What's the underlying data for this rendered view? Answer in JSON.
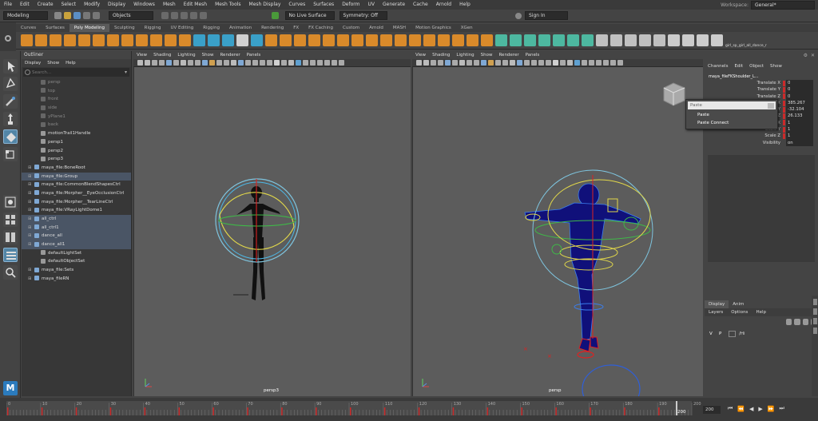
{
  "menu": [
    "File",
    "Edit",
    "Create",
    "Select",
    "Modify",
    "Display",
    "Windows",
    "Mesh",
    "Edit Mesh",
    "Mesh Tools",
    "Mesh Display",
    "Curves",
    "Surfaces",
    "Deform",
    "UV",
    "Generate",
    "Cache",
    "Arnold",
    "Help"
  ],
  "workspace": {
    "label": "Workspace:",
    "value": "General*"
  },
  "status": {
    "mode": "Modeling",
    "objects": "Objects",
    "live_surface": "No Live Surface",
    "symmetry": "Symmetry: Off",
    "sign_in": "Sign In"
  },
  "shelf_tabs": [
    "Curves",
    "Surfaces",
    "Poly Modeling",
    "Sculpting",
    "Rigging",
    "UV Editing",
    "Rigging",
    "Animation",
    "Rendering",
    "FX",
    "FX Caching",
    "Custom",
    "Arnold",
    "MASH",
    "Motion Graphics",
    "XGen"
  ],
  "shelf_active": 2,
  "shelf_extra_label": "girl_sp_girl_all_dance_r",
  "outliner": {
    "title": "Outliner",
    "menus": [
      "Display",
      "Show",
      "Help"
    ],
    "search_placeholder": "Search...",
    "items": [
      {
        "label": "persp",
        "dim": true,
        "exp": false,
        "sel": false
      },
      {
        "label": "top",
        "dim": true,
        "exp": false,
        "sel": false
      },
      {
        "label": "front",
        "dim": true,
        "exp": false,
        "sel": false
      },
      {
        "label": "side",
        "dim": true,
        "exp": false,
        "sel": false
      },
      {
        "label": "yPlane1",
        "dim": true,
        "exp": false,
        "sel": false
      },
      {
        "label": "back",
        "dim": true,
        "exp": false,
        "sel": false
      },
      {
        "label": "motionTrail1Handle",
        "dim": false,
        "exp": false,
        "sel": false
      },
      {
        "label": "persp1",
        "dim": false,
        "exp": false,
        "sel": false
      },
      {
        "label": "persp2",
        "dim": false,
        "exp": false,
        "sel": false
      },
      {
        "label": "persp3",
        "dim": false,
        "exp": false,
        "sel": false
      },
      {
        "label": "maya_file:BoneRoot",
        "dim": false,
        "exp": true,
        "sel": false
      },
      {
        "label": "maya_file:Group",
        "dim": false,
        "exp": true,
        "sel": true
      },
      {
        "label": "maya_file:CommonBlendShapesCtrl",
        "dim": false,
        "exp": true,
        "sel": false
      },
      {
        "label": "maya_file:Morpher__EyeOcclusionCtrl",
        "dim": false,
        "exp": true,
        "sel": false
      },
      {
        "label": "maya_file:Morpher__TearLineCtrl",
        "dim": false,
        "exp": true,
        "sel": false
      },
      {
        "label": "maya_file:VRayLightDome1",
        "dim": false,
        "exp": true,
        "sel": false
      },
      {
        "label": "all_ctrl",
        "dim": false,
        "exp": true,
        "sel": true
      },
      {
        "label": "all_ctrl1",
        "dim": false,
        "exp": true,
        "sel": true
      },
      {
        "label": "dance_all",
        "dim": false,
        "exp": true,
        "sel": true
      },
      {
        "label": "dance_all1",
        "dim": false,
        "exp": true,
        "sel": true
      },
      {
        "label": "defaultLightSet",
        "dim": false,
        "exp": false,
        "sel": false
      },
      {
        "label": "defaultObjectSet",
        "dim": false,
        "exp": false,
        "sel": false
      },
      {
        "label": "maya_file:Sets",
        "dim": false,
        "exp": true,
        "sel": false
      },
      {
        "label": "maya_fileRN",
        "dim": false,
        "exp": true,
        "sel": false
      }
    ]
  },
  "viewport_menus": [
    "View",
    "Shading",
    "Lighting",
    "Show",
    "Renderer",
    "Panels"
  ],
  "viewport_left_cam": "persp3",
  "viewport_right_cam": "persp",
  "channel_box": {
    "menus": [
      "Channels",
      "Edit",
      "Object",
      "Show"
    ],
    "node": "maya_fileFKShoulder_L...",
    "attrs": [
      {
        "name": "Translate X",
        "value": "0"
      },
      {
        "name": "Translate Y",
        "value": "0"
      },
      {
        "name": "Translate Z",
        "value": "0"
      },
      {
        "name": "X",
        "value": "385.267"
      },
      {
        "name": "Y",
        "value": "-32.104"
      },
      {
        "name": "Z",
        "value": "26.133"
      },
      {
        "name": "X",
        "value": "1"
      },
      {
        "name": "Scale Y",
        "value": "1"
      },
      {
        "name": "Scale Z",
        "value": "1"
      },
      {
        "name": "Visibility",
        "value": "on"
      }
    ]
  },
  "paste_menu": {
    "field": "Paste",
    "items": [
      "Paste",
      "Paste Connect"
    ]
  },
  "layer_editor": {
    "tabs": [
      "Display",
      "Anim"
    ],
    "menus": [
      "Layers",
      "Options",
      "Help"
    ],
    "row": {
      "v": "V",
      "p": "P",
      "name": "/Hi"
    }
  },
  "timeline": {
    "ticks": [
      "0",
      "10",
      "20",
      "30",
      "40",
      "50",
      "60",
      "70",
      "80",
      "90",
      "100",
      "110",
      "120",
      "130",
      "140",
      "150",
      "160",
      "170",
      "180",
      "190",
      "200"
    ],
    "current": "200",
    "end_field": "200"
  },
  "colors": {
    "accent": "#5285a6",
    "select": "#4a5565",
    "key": "#cc2a2a"
  }
}
